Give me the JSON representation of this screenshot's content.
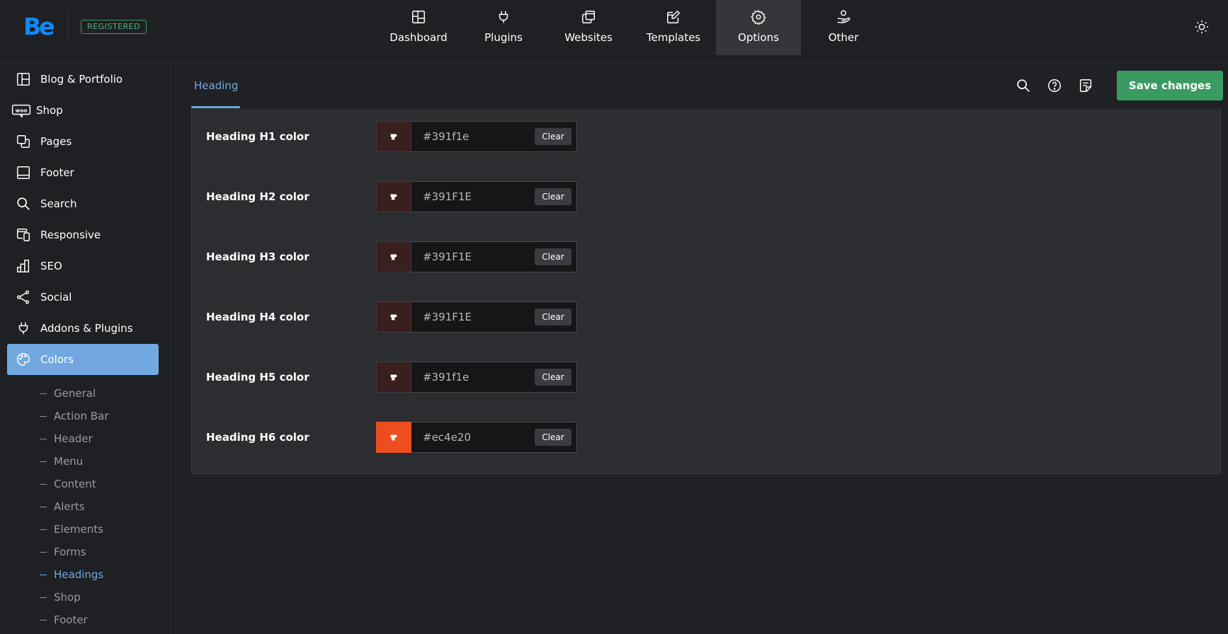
{
  "brand": {
    "logo_text": "Be",
    "badge": "REGISTERED"
  },
  "topnav": [
    {
      "label": "Dashboard",
      "icon": "dashboard-icon",
      "active": false
    },
    {
      "label": "Plugins",
      "icon": "plug-icon",
      "active": false
    },
    {
      "label": "Websites",
      "icon": "websites-icon",
      "active": false
    },
    {
      "label": "Templates",
      "icon": "templates-icon",
      "active": false
    },
    {
      "label": "Options",
      "icon": "gear-icon",
      "active": true
    },
    {
      "label": "Other",
      "icon": "hand-person-icon",
      "active": false
    }
  ],
  "sidebar": {
    "items": [
      {
        "label": "Blog & Portfolio",
        "icon": "layout-icon"
      },
      {
        "label": "Shop",
        "icon": "woo-icon"
      },
      {
        "label": "Pages",
        "icon": "pages-icon"
      },
      {
        "label": "Footer",
        "icon": "footer-icon"
      },
      {
        "label": "Search",
        "icon": "search-icon"
      },
      {
        "label": "Responsive",
        "icon": "responsive-icon"
      },
      {
        "label": "SEO",
        "icon": "chart-bars-icon"
      },
      {
        "label": "Social",
        "icon": "share-icon"
      },
      {
        "label": "Addons & Plugins",
        "icon": "plug-icon"
      },
      {
        "label": "Colors",
        "icon": "palette-icon",
        "active": true
      }
    ],
    "subitems": [
      {
        "label": "General"
      },
      {
        "label": "Action Bar"
      },
      {
        "label": "Header"
      },
      {
        "label": "Menu"
      },
      {
        "label": "Content"
      },
      {
        "label": "Alerts"
      },
      {
        "label": "Elements"
      },
      {
        "label": "Forms"
      },
      {
        "label": "Headings",
        "active": true
      },
      {
        "label": "Shop"
      },
      {
        "label": "Footer"
      }
    ]
  },
  "content": {
    "tab": "Heading",
    "save_label": "Save changes",
    "clear_label": "Clear",
    "rows": [
      {
        "label": "Heading H1 color",
        "value": "#391f1e",
        "swatch": "#391f1e"
      },
      {
        "label": "Heading H2 color",
        "value": "#391F1E",
        "swatch": "#391f1e"
      },
      {
        "label": "Heading H3 color",
        "value": "#391F1E",
        "swatch": "#391f1e"
      },
      {
        "label": "Heading H4 color",
        "value": "#391F1E",
        "swatch": "#391f1e"
      },
      {
        "label": "Heading H5 color",
        "value": "#391f1e",
        "swatch": "#391f1e"
      },
      {
        "label": "Heading H6 color",
        "value": "#ec4e20",
        "swatch": "#ec4e20"
      }
    ]
  },
  "colors": {
    "accent": "#72a8e0",
    "save": "#3a9b62",
    "logo": "#0d8bff"
  }
}
